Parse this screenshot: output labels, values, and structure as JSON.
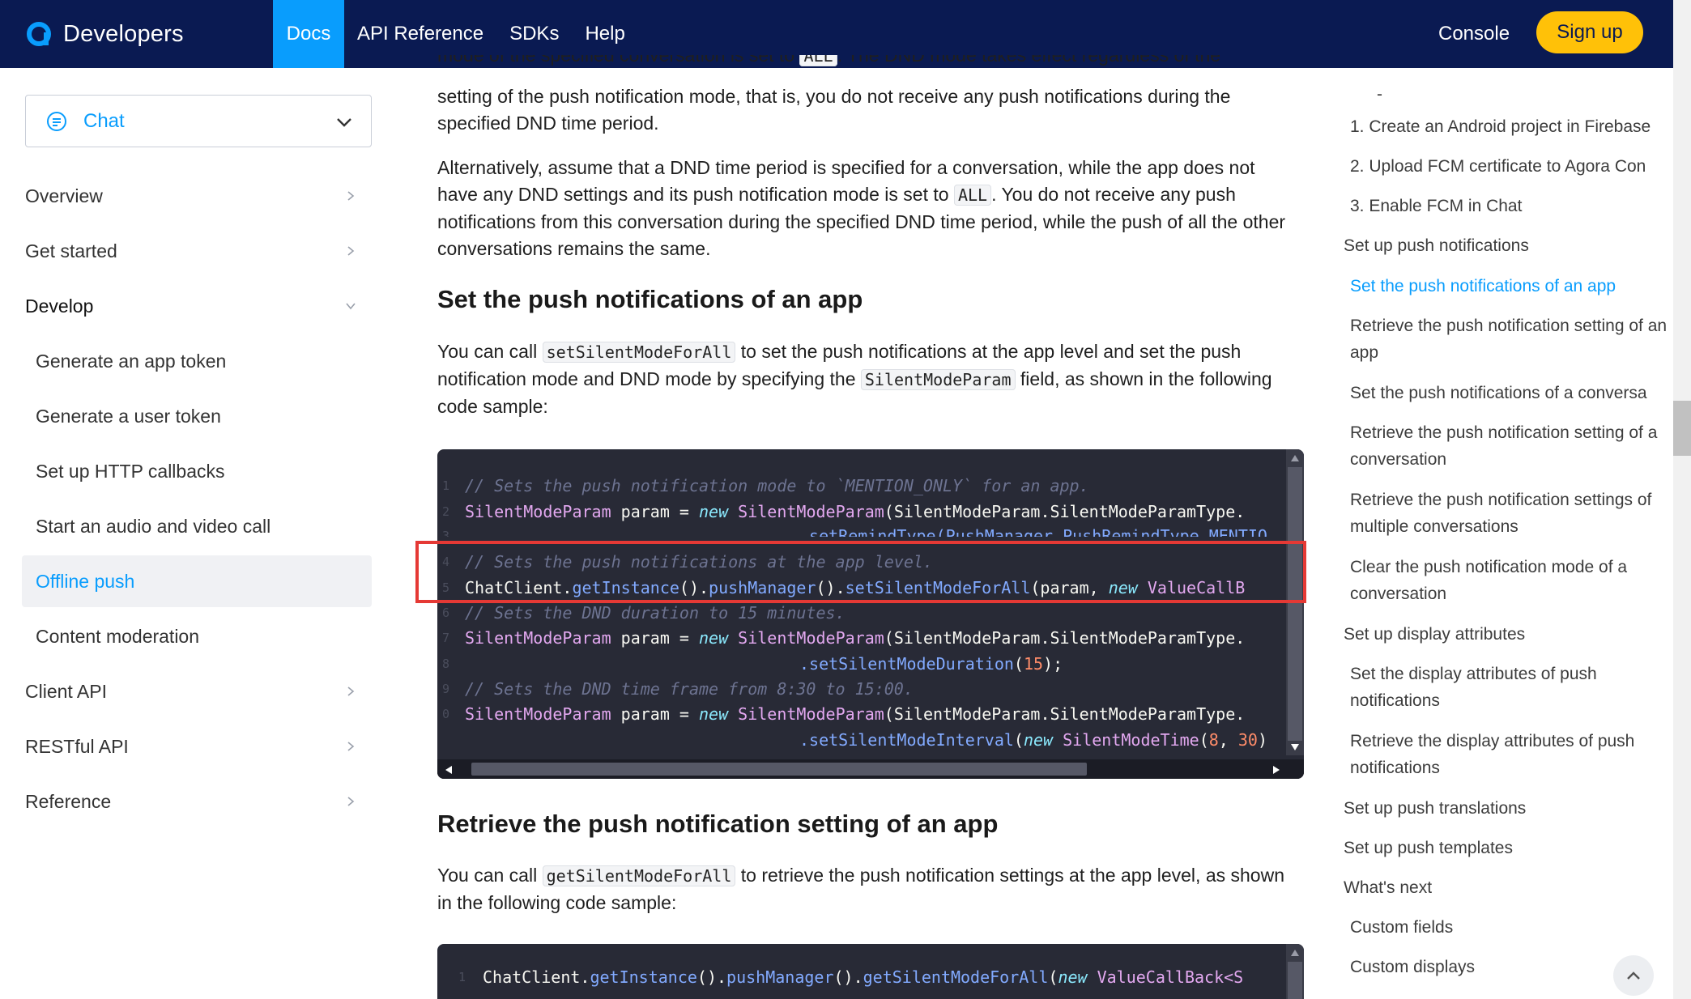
{
  "header": {
    "brand": "Developers",
    "nav": [
      "Docs",
      "API Reference",
      "SDKs",
      "Help"
    ],
    "console": "Console",
    "signup": "Sign up"
  },
  "sidebar": {
    "product": "Chat",
    "items": [
      {
        "label": "Overview"
      },
      {
        "label": "Get started"
      },
      {
        "label": "Develop"
      },
      {
        "label": "Generate an app token"
      },
      {
        "label": "Generate a user token"
      },
      {
        "label": "Set up HTTP callbacks"
      },
      {
        "label": "Start an audio and video call"
      },
      {
        "label": "Offline push"
      },
      {
        "label": "Content moderation"
      },
      {
        "label": "Client API"
      },
      {
        "label": "RESTful API"
      },
      {
        "label": "Reference"
      }
    ]
  },
  "content": {
    "p0_a": "mode of the specified conversation is set to ",
    "p0_code": "ALL",
    "p0_b": ". The DND mode takes effect regardless of the",
    "p1": "setting of the push notification mode, that is, you do not receive any push notifications during the specified DND time period.",
    "p2_a": "Alternatively, assume that a DND time period is specified for a conversation, while the app does not have any DND settings and its push notification mode is set to ",
    "p2_code": "ALL",
    "p2_b": ". You do not receive any push notifications from this conversation during the specified DND time period, while the push of all the other conversations remains the same.",
    "h_set": "Set the push notifications of an app",
    "p3_a": "You can call ",
    "p3_code1": "setSilentModeForAll",
    "p3_b": " to set the push notifications at the app level and set the push notification mode and DND mode by specifying the ",
    "p3_code2": "SilentModeParam",
    "p3_c": " field, as shown in the following code sample:",
    "h_retrieve": "Retrieve the push notification setting of an app",
    "p4_a": "You can call ",
    "p4_code": "getSilentModeForAll",
    "p4_b": " to retrieve the push notification settings at the app level, as shown in the following code sample:"
  },
  "code1": {
    "l1": "// Sets the push notification mode to `MENTION_ONLY` for an app.",
    "l2_ty": "SilentModeParam",
    "l2_a": " param = ",
    "l2_kw": "new",
    "l2_ty2": " SilentModeParam",
    "l2_b": "(SilentModeParam.SilentModeParamType.",
    "l3": ".setRemindType(PushManager.PushRemindType.MENTIO",
    "l4": "// Sets the push notifications at the app level.",
    "l5_a": "ChatClient.",
    "l5_fn1": "getInstance",
    "l5_b": "().",
    "l5_fn2": "pushManager",
    "l5_c": "().",
    "l5_fn3": "setSilentModeForAll",
    "l5_d": "(param, ",
    "l5_kw": "new",
    "l5_ty": " ValueCallB",
    "l6": "// Sets the DND duration to 15 minutes.",
    "l7_ty": "SilentModeParam",
    "l7_a": " param = ",
    "l7_kw": "new",
    "l7_ty2": " SilentModeParam",
    "l7_b": "(SilentModeParam.SilentModeParamType.",
    "l8_fn": ".setSilentModeDuration",
    "l8_a": "(",
    "l8_num": "15",
    "l8_b": ");",
    "l9": "// Sets the DND time frame from 8:30 to 15:00.",
    "l10_ty": "SilentModeParam",
    "l10_a": " param = ",
    "l10_kw": "new",
    "l10_ty2": " SilentModeParam",
    "l10_b": "(SilentModeParam.SilentModeParamType.",
    "l11_fn": ".setSilentModeInterval",
    "l11_a": "(",
    "l11_kw": "new",
    "l11_ty": " SilentModeTime",
    "l11_b": "(",
    "l11_n1": "8",
    "l11_c": ", ",
    "l11_n2": "30",
    "l11_d": ")"
  },
  "code2": {
    "l1_a": "ChatClient.",
    "l1_fn1": "getInstance",
    "l1_b": "().",
    "l1_fn2": "pushManager",
    "l1_c": "().",
    "l1_fn3": "getSilentModeForAll",
    "l1_d": "(",
    "l1_kw": "new",
    "l1_ty": " ValueCallBack<S"
  },
  "toc": {
    "dash": "-",
    "items": [
      "1. Create an Android project in Firebase",
      "2. Upload FCM certificate to Agora Con",
      "3. Enable FCM in Chat",
      "Set up push notifications",
      "Set the push notifications of an app",
      "Retrieve the push notification setting of an app",
      "Set the push notifications of a conversa",
      "Retrieve the push notification setting of a conversation",
      "Retrieve the push notification settings of multiple conversations",
      "Clear the push notification mode of a conversation",
      "Set up display attributes",
      "Set the display attributes of push notifications",
      "Retrieve the display attributes of push notifications",
      "Set up push translations",
      "Set up push templates",
      "What's next",
      "Custom fields",
      "Custom displays"
    ]
  },
  "colors": {
    "header_bg": "#0a1a52",
    "accent": "#099dfd",
    "signup_bg": "#ffc108",
    "highlight": "#e53935"
  }
}
